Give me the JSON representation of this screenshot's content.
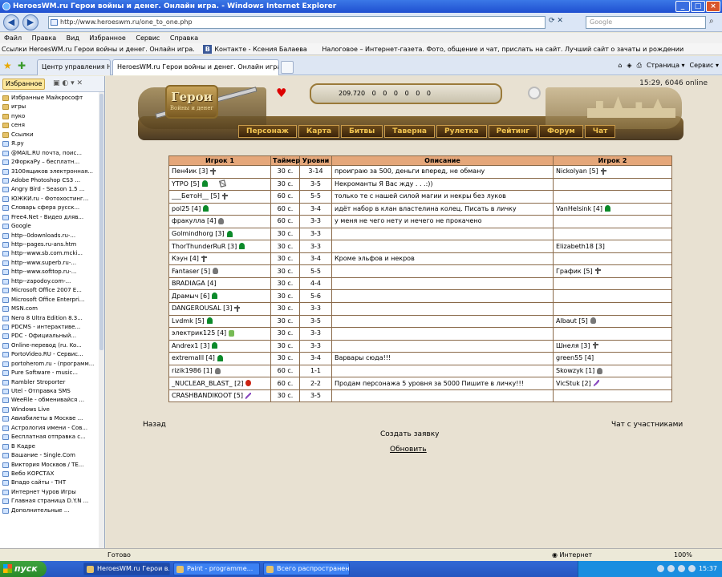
{
  "window": {
    "title": "HeroesWM.ru Герои войны и денег. Онлайн игра. - Windows Internet Explorer"
  },
  "address": {
    "url": "http://www.heroeswm.ru/one_to_one.php",
    "search_placeholder": "Google"
  },
  "menu": [
    "Файл",
    "Правка",
    "Вид",
    "Избранное",
    "Сервис",
    "Справка"
  ],
  "links_bar": [
    "Ссылки HeroesWM.ru Герои войны и денег. Онлайн игра.",
    "Контакте - Ксения Балаева",
    "Налоговое – Интернет-газета. Фото, общение и чат, прислать на сайт. Лучший сайт о зачаты и рождении"
  ],
  "links_tag": "B",
  "tabs": [
    "Центр управления Н...",
    "HeroesWM.ru Герои войны и денег. Онлайн игра."
  ],
  "command_bar": [
    "Страница ▾",
    "Сервис ▾"
  ],
  "favorites": {
    "button": "Избранное",
    "items": [
      "Избранные Майкрософт",
      "игры",
      "пуко",
      "сеня",
      "Ссылки",
      "Я.ру",
      "@MAIL.RU почта, поис...",
      "2ФоркаРу – бесплатн...",
      "3100ящиков электронная...",
      "Adobe Photoshop CS3 ...",
      "Angry Bird - Season 1.5 ...",
      "ЮЖКИ.ru - Фотохостинг...",
      "Словарь сфера русск...",
      "Free4.Net - Видео дляв...",
      "Google",
      "http--0downloads.ru-...",
      "http--pages.ru-ans.htm",
      "http--www.sb.com.mcki...",
      "http--www.superb.ru-...",
      "http--www.softtop.ru-...",
      "http--zapodoy.com-...",
      "Microsoft Office 2007 E...",
      "Microsoft Office Enterpri...",
      "MSN.com",
      "Nero 8 Ultra Edition 8.3...",
      "PDCMS - интерактиве...",
      "PDC - Официальный...",
      "Online-перевод (ru. Ko...",
      "PortoVideo.RU - Сервис...",
      "portoherom.ru - (программ...",
      "Pure Software - music...",
      "Rambler Stroporter",
      "Utel - Отправка SMS",
      "WeeFile - обменивайся ...",
      "Windows Live",
      "Авиабилеты в Москве ...",
      "Астрология имени - Сов...",
      "Бесплатная отправка с...",
      "В Кадре",
      "Вашание - Single.Com",
      "Виктория Москвов / ТЕ...",
      "Вебо КОРСТАХ",
      "Впадо сайты - ТНТ",
      "Интернет Чуров Игры",
      "Главная страница D.Y.N ...",
      "Дополнительные ..."
    ]
  },
  "game": {
    "online": "15:29, 6046 online",
    "logo_title": "Герои",
    "logo_subtitle": "Войны и денег",
    "resources": [
      "209.720",
      "0",
      "0",
      "0",
      "0",
      "0",
      "0"
    ],
    "nav": [
      "Персонаж",
      "Карта",
      "Битвы",
      "Таверна",
      "Рулетка",
      "Рейтинг",
      "Форум",
      "Чат"
    ],
    "table": {
      "headers": [
        "Игрок 1",
        "Таймер",
        "Уровни",
        "Описание",
        "Игрок 2"
      ],
      "rows": [
        {
          "p1": "Пен4ик [3]",
          "i1": "cross",
          "timer": "30 с.",
          "levels": "3-14",
          "desc": "проиграю за 500, деньги вперед, не обману",
          "p2": "Nickolyan [5]",
          "i2": "cross"
        },
        {
          "p1": "YTPO [5]",
          "i1": "tree",
          "timer": "30 с.",
          "levels": "3-5",
          "desc": "Некроманты Я Вас жду . . .:))",
          "p2": "",
          "i2": ""
        },
        {
          "p1": "___БетоН__ [5]",
          "i1": "cross",
          "timer": "60 с.",
          "levels": "5-5",
          "desc": "только те с нашей силой магии и некры без луков",
          "p2": "",
          "i2": ""
        },
        {
          "p1": "pol25 [4]",
          "i1": "tree",
          "timer": "60 с.",
          "levels": "3-4",
          "desc": "идёт набор в клан властелина колец. Писать в личку",
          "p2": "VanHelsink [4]",
          "i2": "tree"
        },
        {
          "p1": "фракулла [4]",
          "i1": "skull",
          "timer": "60 с.",
          "levels": "3-3",
          "desc": "у меня не чего нету и нечего не прокачено",
          "p2": "",
          "i2": ""
        },
        {
          "p1": "Golmindhorg [3]",
          "i1": "tree",
          "timer": "30 с.",
          "levels": "3-3",
          "desc": "",
          "p2": "",
          "i2": ""
        },
        {
          "p1": "ThorThunderRuR [3]",
          "i1": "tree",
          "timer": "30 с.",
          "levels": "3-3",
          "desc": "",
          "p2": "Elizabeth18 [3]",
          "i2": "sword"
        },
        {
          "p1": "Кэун [4]",
          "i1": "cross",
          "timer": "30 с.",
          "levels": "3-4",
          "desc": "Кроме эльфов и некров",
          "p2": "",
          "i2": ""
        },
        {
          "p1": "Fantaser [5]",
          "i1": "skull",
          "timer": "30 с.",
          "levels": "5-5",
          "desc": "",
          "p2": "График [5]",
          "i2": "cross"
        },
        {
          "p1": "BRADIAGA [4]",
          "i1": "sword",
          "timer": "30 с.",
          "levels": "4-4",
          "desc": "",
          "p2": "",
          "i2": ""
        },
        {
          "p1": "Драмыч [6]",
          "i1": "tree",
          "timer": "30 с.",
          "levels": "5-6",
          "desc": "",
          "p2": "",
          "i2": ""
        },
        {
          "p1": "DANGEROUSAL [3]",
          "i1": "cross",
          "timer": "30 с.",
          "levels": "3-3",
          "desc": "",
          "p2": "",
          "i2": ""
        },
        {
          "p1": "Lvdmk [5]",
          "i1": "tree",
          "timer": "30 с.",
          "levels": "3-5",
          "desc": "",
          "p2": "Albaut [5]",
          "i2": "skull"
        },
        {
          "p1": "электрик125 [4]",
          "i1": "sprite",
          "timer": "30 с.",
          "levels": "3-3",
          "desc": "",
          "p2": "",
          "i2": ""
        },
        {
          "p1": "Andrex1 [3]",
          "i1": "tree",
          "timer": "30 с.",
          "levels": "3-3",
          "desc": "",
          "p2": "Шнеля [3]",
          "i2": "cross"
        },
        {
          "p1": "extremalll [4]",
          "i1": "tree",
          "timer": "30 с.",
          "levels": "3-4",
          "desc": "Варвары сюда!!!",
          "p2": "green55 [4]",
          "i2": "sword"
        },
        {
          "p1": "rizik1986 [1]",
          "i1": "skull",
          "timer": "60 с.",
          "levels": "1-1",
          "desc": "",
          "p2": "Skowzyk [1]",
          "i2": "skull"
        },
        {
          "p1": "_NUCLEAR_BLAST_ [2]",
          "i1": "demon",
          "timer": "60 с.",
          "levels": "2-2",
          "desc": "Продам персонажа 5 уровня за 5000 Пишите в личку!!!",
          "p2": "VicStuk [2]",
          "i2": "staff"
        },
        {
          "p1": "CRASHBANDIKOOT [5]",
          "i1": "staff",
          "timer": "30 с.",
          "levels": "3-5",
          "desc": "",
          "p2": "",
          "i2": ""
        }
      ]
    },
    "back": "Назад",
    "chat_link": "Чат с участниками",
    "create": "Создать заявку",
    "refresh": "Обновить"
  },
  "status": {
    "left": "Готово",
    "zone": "Интернет",
    "zoom": "100%"
  },
  "taskbar": {
    "start": "пуск",
    "items": [
      "HeroesWM.ru Герои в...",
      "Paint - programme...",
      "Всего распространено..."
    ],
    "clock": "15:37"
  }
}
